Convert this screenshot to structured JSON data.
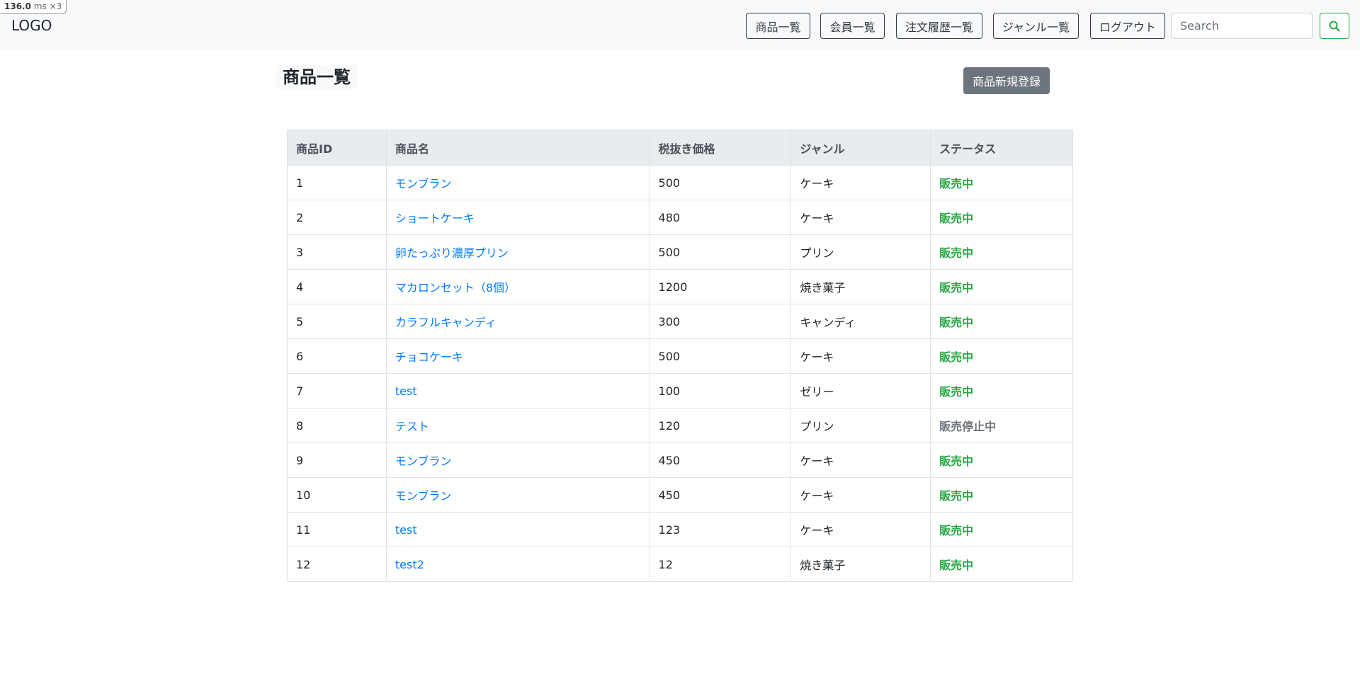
{
  "perf_badge": {
    "value": "136.0",
    "unit": "ms",
    "multiplier": "×3"
  },
  "navbar": {
    "logo": "LOGO",
    "links": [
      "商品一覧",
      "会員一覧",
      "注文履歴一覧",
      "ジャンル一覧",
      "ログアウト"
    ],
    "search_placeholder": "Search",
    "search_icon": "search-icon"
  },
  "page": {
    "title": "商品一覧",
    "new_button": "商品新規登録"
  },
  "table": {
    "headers": [
      "商品ID",
      "商品名",
      "税抜き価格",
      "ジャンル",
      "ステータス"
    ],
    "rows": [
      {
        "id": "1",
        "name": "モンブラン",
        "price": "500",
        "genre": "ケーキ",
        "status": "販売中",
        "active": true
      },
      {
        "id": "2",
        "name": "ショートケーキ",
        "price": "480",
        "genre": "ケーキ",
        "status": "販売中",
        "active": true
      },
      {
        "id": "3",
        "name": "卵たっぷり濃厚プリン",
        "price": "500",
        "genre": "プリン",
        "status": "販売中",
        "active": true
      },
      {
        "id": "4",
        "name": "マカロンセット（8個）",
        "price": "1200",
        "genre": "焼き菓子",
        "status": "販売中",
        "active": true
      },
      {
        "id": "5",
        "name": "カラフルキャンディ",
        "price": "300",
        "genre": "キャンディ",
        "status": "販売中",
        "active": true
      },
      {
        "id": "6",
        "name": "チョコケーキ",
        "price": "500",
        "genre": "ケーキ",
        "status": "販売中",
        "active": true
      },
      {
        "id": "7",
        "name": "test",
        "price": "100",
        "genre": "ゼリー",
        "status": "販売中",
        "active": true
      },
      {
        "id": "8",
        "name": "テスト",
        "price": "120",
        "genre": "プリン",
        "status": "販売停止中",
        "active": false
      },
      {
        "id": "9",
        "name": "モンブラン",
        "price": "450",
        "genre": "ケーキ",
        "status": "販売中",
        "active": true
      },
      {
        "id": "10",
        "name": "モンブラン",
        "price": "450",
        "genre": "ケーキ",
        "status": "販売中",
        "active": true
      },
      {
        "id": "11",
        "name": "test",
        "price": "123",
        "genre": "ケーキ",
        "status": "販売中",
        "active": true
      },
      {
        "id": "12",
        "name": "test2",
        "price": "12",
        "genre": "焼き菓子",
        "status": "販売中",
        "active": true
      }
    ]
  },
  "colors": {
    "navbar_bg": "#f8f9fa",
    "link": "#007bff",
    "status_active": "#28a745",
    "status_inactive": "#6c757d",
    "new_button_bg": "#6c757d",
    "table_header_bg": "#e9ecef"
  }
}
